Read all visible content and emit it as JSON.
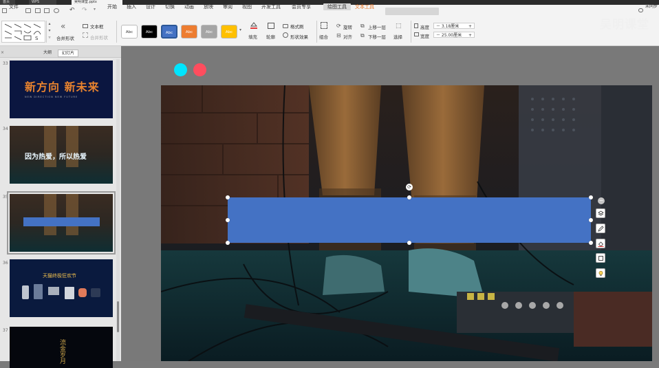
{
  "window": {
    "tabs": [
      "首页",
      "WPS",
      "吴明课堂.pptx"
    ]
  },
  "menu": {
    "file": "文件",
    "items": [
      "开始",
      "插入",
      "设计",
      "切换",
      "动画",
      "放映",
      "审阅",
      "视图",
      "开发工具",
      "会员专享"
    ],
    "active_context": "绘图工具",
    "text_tool": "文本工具",
    "right_label": "未同步"
  },
  "ribbon": {
    "format_painter": "格式刷",
    "shape_label": "Abc",
    "text_box": "文本框",
    "merge_shape": "合并形状",
    "fill": "填充",
    "outline": "轮廓",
    "format_brush": "格式刷",
    "shape_effect": "形状效果",
    "group": "组合",
    "rotate": "旋转",
    "align": "对齐",
    "bring_forward": "上移一层",
    "send_backward": "下移一层",
    "select": "选择",
    "height_label": "高度",
    "height_value": "3.18厘米",
    "width_label": "宽度",
    "width_value": "25.00厘米",
    "swatches": [
      {
        "label": "Abc",
        "bg": "#ffffff",
        "fg": "#333333"
      },
      {
        "label": "Abc",
        "bg": "#000000",
        "fg": "#ffffff"
      },
      {
        "label": "Abc",
        "bg": "#4472c4",
        "fg": "#ffffff"
      },
      {
        "label": "Abc",
        "bg": "#ed7d31",
        "fg": "#ffffff"
      },
      {
        "label": "Abc",
        "bg": "#a5a5a5",
        "fg": "#ffffff"
      },
      {
        "label": "Abc",
        "bg": "#ffc000",
        "fg": "#ffffff"
      }
    ]
  },
  "panel": {
    "tab_outline": "大纲",
    "tab_slides": "幻灯片",
    "slides": [
      {
        "num": "33",
        "title": "新方向 新未来",
        "subtitle": "NEW DIRECTION NEW FUTURE"
      },
      {
        "num": "34",
        "title": "因为热爱，所以热爱"
      },
      {
        "num": "35"
      },
      {
        "num": "36",
        "title": "天猫终极狂欢节"
      },
      {
        "num": "37",
        "title": "流金岁月"
      }
    ]
  },
  "stage": {
    "dot_cyan": "#00e5ff",
    "dot_red": "#ff4d5e",
    "shape_color": "#4472c4"
  },
  "watermark": "吴明课堂"
}
